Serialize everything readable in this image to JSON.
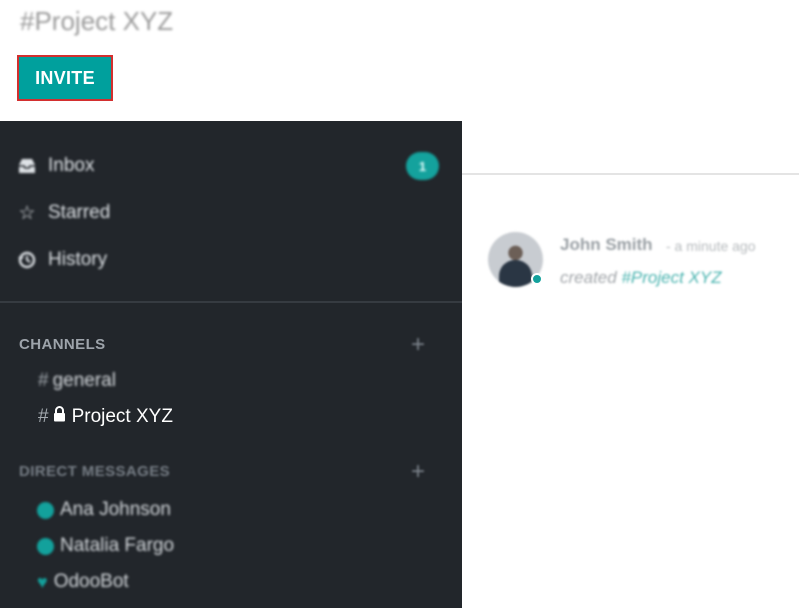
{
  "header": {
    "title": "#Project XYZ",
    "invite_label": "INVITE"
  },
  "sidebar": {
    "nav": [
      {
        "label": "Inbox",
        "icon": "inbox-icon",
        "counter": "1"
      },
      {
        "label": "Starred",
        "icon": "star-icon"
      },
      {
        "label": "History",
        "icon": "history-icon"
      }
    ],
    "channels_header": "CHANNELS",
    "channels": [
      {
        "hash": "#",
        "label": "general"
      },
      {
        "hash": "#",
        "label": "Project XYZ",
        "icon": "lock-icon"
      }
    ],
    "dm_header": "DIRECT MESSAGES",
    "direct_messages": [
      {
        "label": "Ana Johnson",
        "status": "online"
      },
      {
        "label": "Natalia Fargo",
        "status": "online"
      },
      {
        "label": "OdooBot",
        "icon": "heart-icon"
      }
    ],
    "add_symbol": "+"
  },
  "message": {
    "author": "John Smith",
    "time": "- a minute ago",
    "body_prefix": "created",
    "body_link": "#Project XYZ"
  },
  "colors": {
    "accent": "#00a09d",
    "sidebar_bg": "#22262b",
    "invite_border": "#d32f2f"
  }
}
